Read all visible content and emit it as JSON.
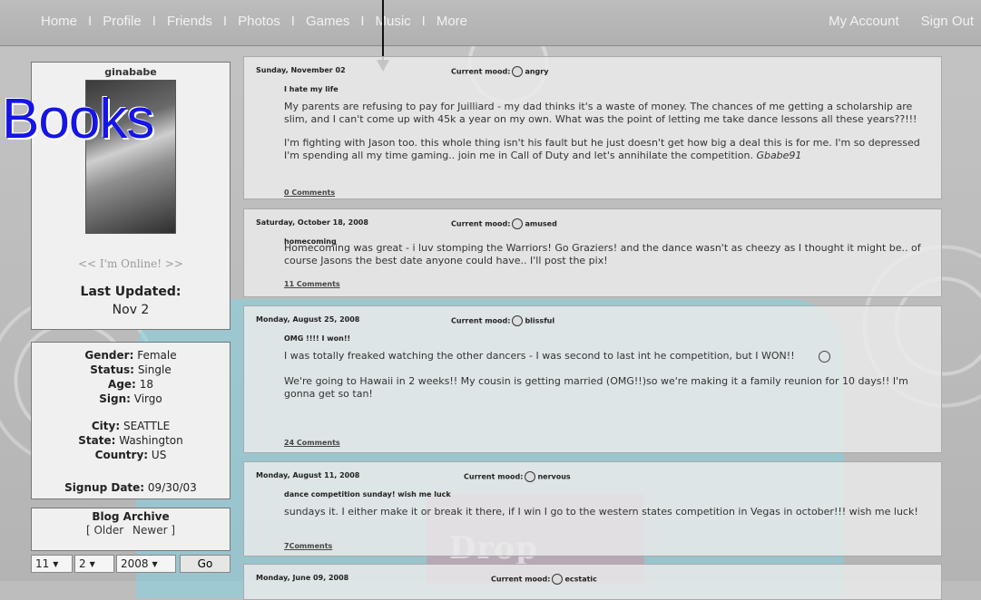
{
  "nav": {
    "left": [
      "Home",
      "Profile",
      "Friends",
      "Photos",
      "Games",
      "Music",
      "More"
    ],
    "separator": "I",
    "right": [
      "My Account",
      "Sign Out"
    ]
  },
  "label": "Books",
  "profile": {
    "username": "ginababe",
    "online": "<< I'm Online! >>",
    "last_updated_label": "Last Updated:",
    "last_updated": "Nov 2"
  },
  "info": {
    "gender_label": "Gender:",
    "gender": "Female",
    "status_label": "Status:",
    "status": "Single",
    "age_label": "Age:",
    "age": "18",
    "sign_label": "Sign:",
    "sign": "Virgo",
    "city_label": "City:",
    "city": "SEATTLE",
    "state_label": "State:",
    "state": "Washington",
    "country_label": "Country:",
    "country": "US",
    "signup_label": "Signup Date:",
    "signup": "09/30/03"
  },
  "archive": {
    "title": "Blog Archive",
    "older": "[ Older",
    "newer": "Newer ]",
    "month": "11",
    "day": "2",
    "year": "2008",
    "go": "Go"
  },
  "watermark": "Drop",
  "posts": [
    {
      "date": "Sunday, November 02",
      "mood_label": "Current mood:",
      "mood": "angry",
      "title": "I hate my life",
      "para1": "My parents are refusing to pay for Juilliard - my dad thinks it's a waste of money. The chances of me getting a scholarship are slim, and I can't come up with 45k a year on my own. What was the point of letting me take dance lessons all these years??!!!",
      "para2": "I'm fighting with Jason too. this whole thing isn't his fault but he just doesn't get how big a deal this is for me.  I'm so depressed I'm spending all my time gaming.. join me in Call of Duty and let's annihilate the competition.",
      "signature": "Gbabe91",
      "comments": "0 Comments"
    },
    {
      "date": "Saturday, October 18, 2008",
      "mood_label": "Current mood:",
      "mood": "amused",
      "title": "homecoming",
      "para1": "Homecoming was great - i luv stomping the Warriors! Go Graziers! and the dance wasn't as cheezy as I thought it might be.. of course Jasons the best date anyone could have.. I'll post the pix!",
      "comments": "11 Comments"
    },
    {
      "date": "Monday, August 25, 2008",
      "mood_label": "Current mood:",
      "mood": "blissful",
      "title": "OMG !!!! I won!!",
      "para1": "I was totally freaked watching the other dancers - I was second to last int he competition, but I WON!!",
      "para2": "We're going to Hawaii in 2 weeks!! My cousin is getting married (OMG!!)so we're making it a family reunion for 10 days!! I'm gonna get so tan!",
      "comments": "24 Comments"
    },
    {
      "date": "Monday, August 11, 2008",
      "mood_label": "Current mood:",
      "mood": "nervous",
      "title": "dance competition sunday! wish me luck",
      "para1": "sundays it. I either make it or break it there, if I win I go to the western states competition in Vegas in october!!! wish me luck!",
      "comments": "7Comments"
    },
    {
      "date": "Monday, June 09, 2008",
      "mood_label": "Current mood:",
      "mood": "ecstatic"
    }
  ]
}
